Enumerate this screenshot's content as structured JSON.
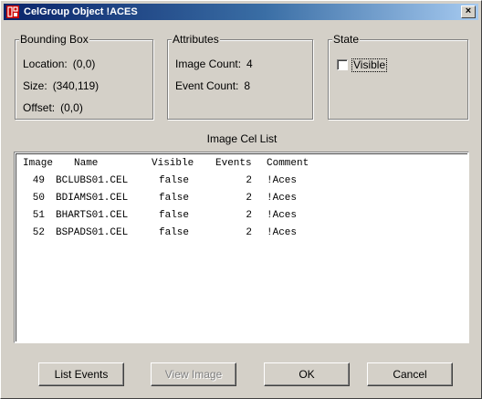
{
  "window": {
    "title": "CelGroup Object !ACES",
    "close_glyph": "×"
  },
  "bounding_box": {
    "label": "Bounding Box",
    "location_label": "Location:",
    "location_value": "(0,0)",
    "size_label": "Size:",
    "size_value": "(340,119)",
    "offset_label": "Offset:",
    "offset_value": "(0,0)"
  },
  "attributes": {
    "label": "Attributes",
    "image_count_label": "Image Count:",
    "image_count_value": "4",
    "event_count_label": "Event Count:",
    "event_count_value": "8"
  },
  "state": {
    "label": "State",
    "visible_label": "Visible",
    "visible_checked": false
  },
  "list": {
    "title": "Image Cel List",
    "columns": {
      "image": "Image",
      "name": "Name",
      "visible": "Visible",
      "events": "Events",
      "comment": "Comment"
    },
    "rows": [
      {
        "image": "49",
        "name": "BCLUBS01.CEL",
        "visible": "false",
        "events": "2",
        "comment": "!Aces"
      },
      {
        "image": "50",
        "name": "BDIAMS01.CEL",
        "visible": "false",
        "events": "2",
        "comment": "!Aces"
      },
      {
        "image": "51",
        "name": "BHARTS01.CEL",
        "visible": "false",
        "events": "2",
        "comment": "!Aces"
      },
      {
        "image": "52",
        "name": "BSPADS01.CEL",
        "visible": "false",
        "events": "2",
        "comment": "!Aces"
      }
    ]
  },
  "buttons": {
    "list_events": "List Events",
    "view_image": "View Image",
    "ok": "OK",
    "cancel": "Cancel"
  },
  "colors": {
    "title_start": "#0a246a",
    "title_end": "#a6caf0",
    "face": "#d4d0c8",
    "icon_red": "#cc0000"
  }
}
